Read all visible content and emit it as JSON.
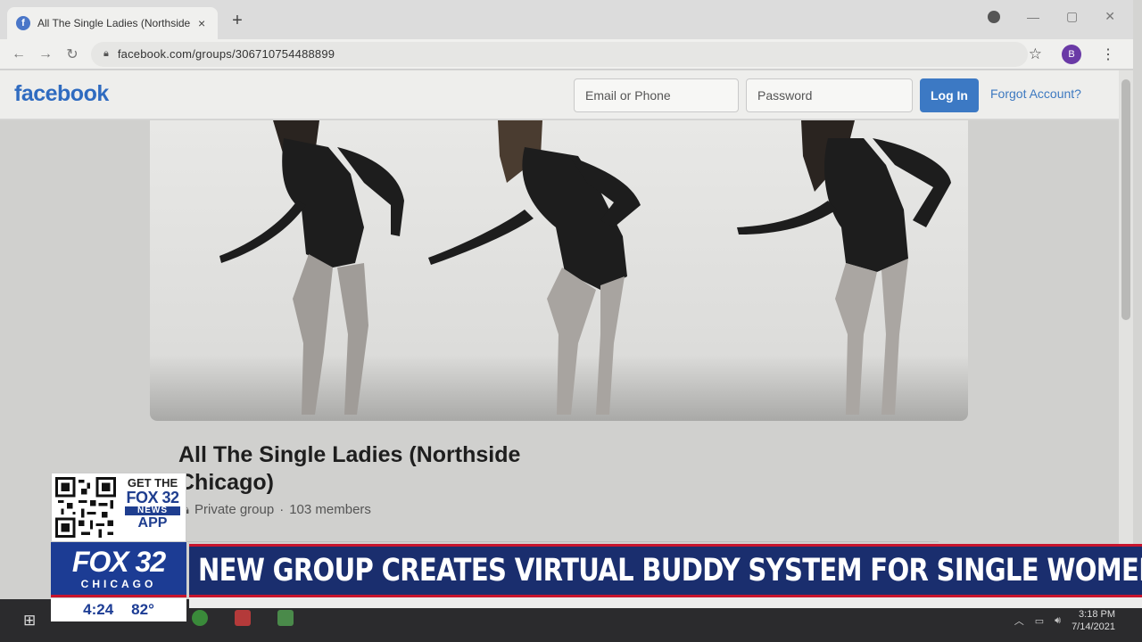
{
  "browser": {
    "tab_title": "All The Single Ladies (Northside C",
    "tab_close": "×",
    "new_tab": "+",
    "url": "facebook.com/groups/306710754488899",
    "profile_initial": "B"
  },
  "facebook": {
    "logo": "facebook",
    "email_placeholder": "Email or Phone",
    "password_placeholder": "Password",
    "login_label": "Log In",
    "forgot_label": "Forgot Account?"
  },
  "group": {
    "name": "All The Single Ladies (Northside Chicago)",
    "privacy": "Private group",
    "separator": "·",
    "members": "103 members"
  },
  "taskbar": {
    "time": "3:18 PM",
    "date": "7/14/2021"
  },
  "broadcast": {
    "promo_get": "GET THE",
    "promo_fox": "FOX 32",
    "promo_news": "NEWS",
    "promo_app": "APP",
    "station_logo": "FOX 32",
    "station_city": "CHICAGO",
    "time": "4:24",
    "temperature": "82°",
    "headline": "NEW GROUP CREATES VIRTUAL BUDDY SYSTEM FOR SINGLE WOMEN",
    "brand_color": "#1c3c94",
    "accent_color": "#c8142d"
  }
}
